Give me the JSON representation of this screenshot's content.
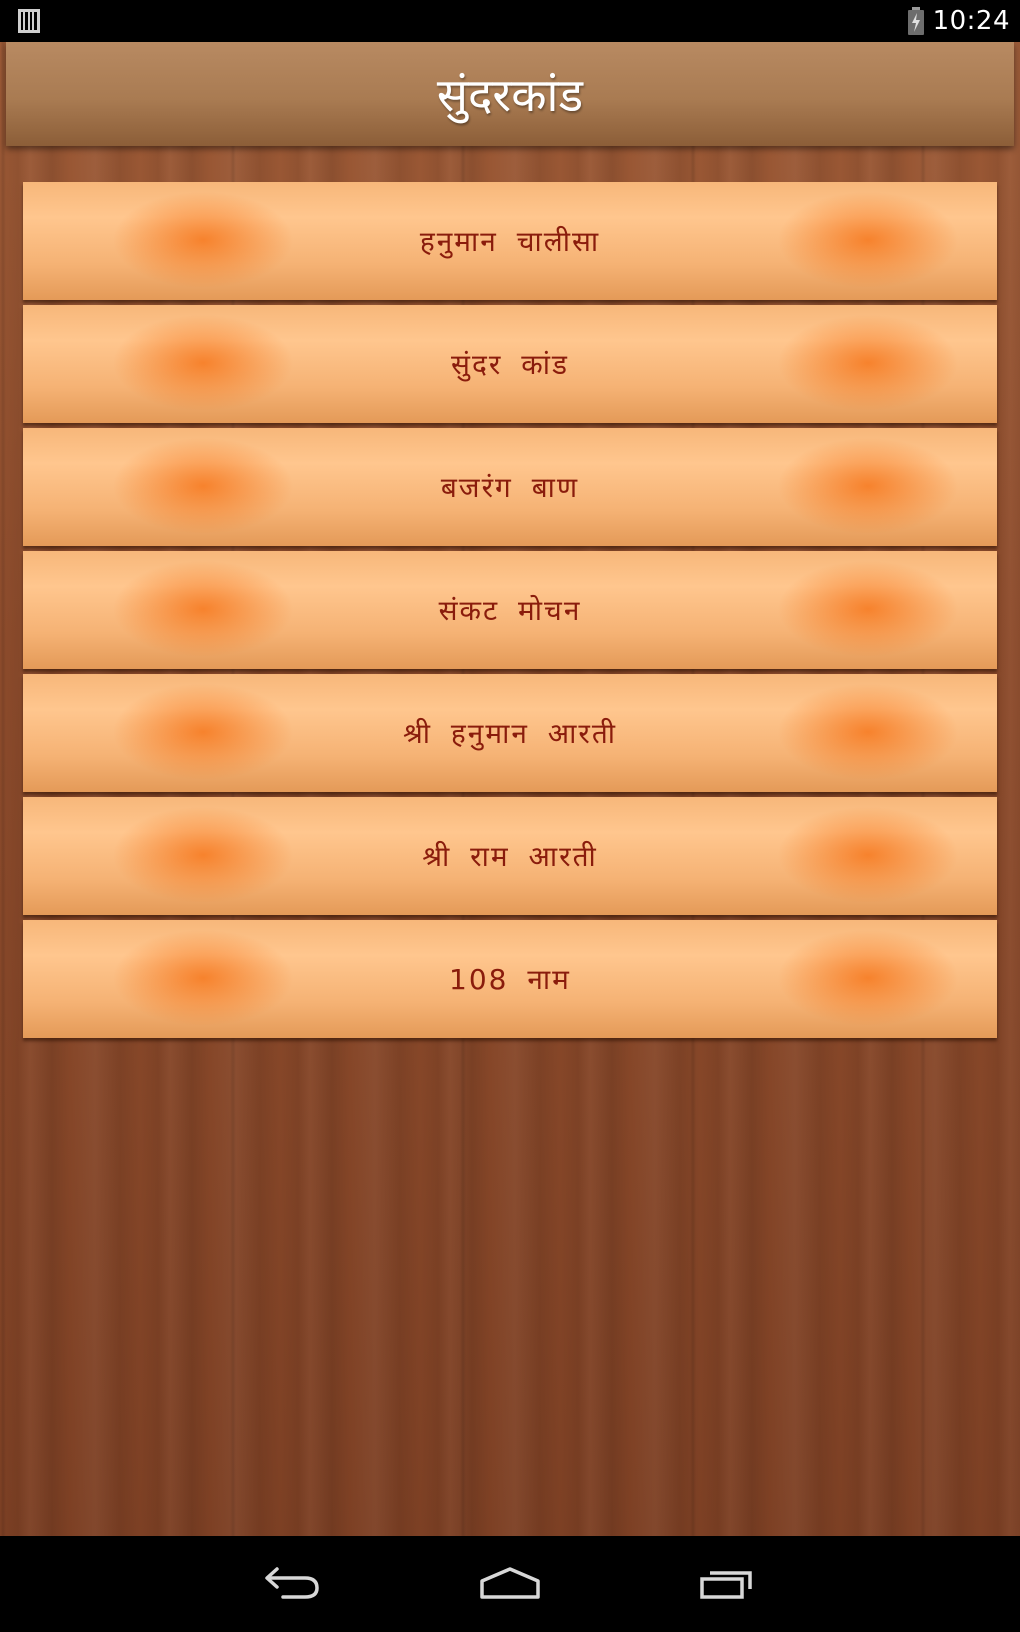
{
  "status_bar": {
    "time": "10:24",
    "left_icon": "barcode-notification-icon",
    "battery_icon": "battery-charging-icon"
  },
  "header": {
    "title": "सुंदरकांड"
  },
  "menu": {
    "items": [
      {
        "label": "हनुमान चालीसा"
      },
      {
        "label": "सुंदर कांड"
      },
      {
        "label": "बजरंग बाण"
      },
      {
        "label": "संकट मोचन"
      },
      {
        "label": "श्री हनुमान आरती"
      },
      {
        "label": "श्री राम आरती"
      },
      {
        "label": "108 नाम"
      }
    ]
  },
  "nav_bar": {
    "back_icon": "back-icon",
    "home_icon": "home-icon",
    "recent_icon": "recent-apps-icon"
  },
  "colors": {
    "header_bg": "#a97b52",
    "item_bg": "#ffc68e",
    "item_text": "#8a1c0c",
    "wood": "#8e4c2c"
  }
}
